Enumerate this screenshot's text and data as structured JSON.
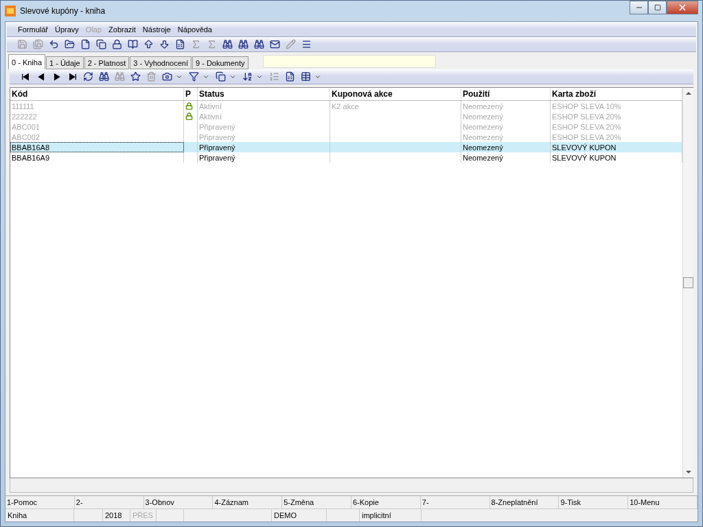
{
  "window": {
    "title": "Slevové kupóny - kniha"
  },
  "menu": [
    {
      "label": "Formulář",
      "disabled": false
    },
    {
      "label": "Úpravy",
      "disabled": false
    },
    {
      "label": "Olap",
      "disabled": true
    },
    {
      "label": "Zobrazit",
      "disabled": false
    },
    {
      "label": "Nástroje",
      "disabled": false
    },
    {
      "label": "Nápověda",
      "disabled": false
    }
  ],
  "toolbar": [
    {
      "kind": "save",
      "disabled": true
    },
    {
      "kind": "save-as",
      "disabled": true
    },
    {
      "kind": "undo",
      "disabled": false
    },
    {
      "kind": "open",
      "disabled": false
    },
    {
      "kind": "new",
      "disabled": false
    },
    {
      "kind": "copy",
      "disabled": false
    },
    {
      "kind": "lock",
      "disabled": false
    },
    {
      "kind": "book",
      "disabled": false
    },
    {
      "kind": "up",
      "disabled": false
    },
    {
      "kind": "down",
      "disabled": false
    },
    {
      "kind": "sheet",
      "disabled": false
    },
    {
      "kind": "sum",
      "disabled": true
    },
    {
      "kind": "sum",
      "disabled": true
    },
    {
      "kind": "find",
      "disabled": false
    },
    {
      "kind": "find",
      "disabled": false
    },
    {
      "kind": "find",
      "disabled": false
    },
    {
      "kind": "mail",
      "disabled": false
    },
    {
      "kind": "edit",
      "disabled": true
    },
    {
      "kind": "menu",
      "disabled": false
    }
  ],
  "tabs": [
    {
      "label": "0 - Kniha",
      "selected": true
    },
    {
      "label": "1 - Údaje",
      "selected": false
    },
    {
      "label": "2 - Platnost",
      "selected": false
    },
    {
      "label": "3 - Vyhodnocení",
      "selected": false
    },
    {
      "label": "9 - Dokumenty",
      "selected": false
    }
  ],
  "grid_toolbar": [
    {
      "kind": "first",
      "disabled": false
    },
    {
      "kind": "prev",
      "disabled": false
    },
    {
      "kind": "next",
      "disabled": false
    },
    {
      "kind": "last",
      "disabled": false
    },
    {
      "kind": "refresh",
      "disabled": false
    },
    {
      "kind": "find",
      "disabled": false
    },
    {
      "kind": "find",
      "disabled": true
    },
    {
      "kind": "star",
      "disabled": false
    },
    {
      "kind": "remove",
      "disabled": true
    },
    {
      "kind": "camera",
      "disabled": false,
      "dropdown": true
    },
    {
      "kind": "filter",
      "disabled": false,
      "dropdown": true
    },
    {
      "kind": "copy",
      "disabled": false,
      "dropdown": true
    },
    {
      "kind": "sort",
      "disabled": false,
      "dropdown": true
    },
    {
      "kind": "list",
      "disabled": true
    },
    {
      "kind": "sheet",
      "disabled": false
    },
    {
      "kind": "table",
      "disabled": false,
      "dropdown": true
    }
  ],
  "table": {
    "columns": [
      "Kód",
      "P",
      "Status",
      "Kuponová akce",
      "Použití",
      "Karta zboží"
    ],
    "rows": [
      {
        "cells": [
          "111111",
          "",
          "Aktivní",
          "K2 akce",
          "Neomezený",
          "ESHOP SLEVA 10%"
        ],
        "locked": true,
        "dimmed": true,
        "selected": false
      },
      {
        "cells": [
          "222222",
          "",
          "Aktivní",
          "",
          "Neomezený",
          "ESHOP SLEVA 20%"
        ],
        "locked": true,
        "dimmed": true,
        "selected": false
      },
      {
        "cells": [
          "ABC001",
          "",
          "Připravený",
          "",
          "Neomezený",
          "ESHOP SLEVA 20%"
        ],
        "locked": false,
        "dimmed": true,
        "selected": false
      },
      {
        "cells": [
          "ABC002",
          "",
          "Připravený",
          "",
          "Neomezený",
          "ESHOP SLEVA 20%"
        ],
        "locked": false,
        "dimmed": true,
        "selected": false
      },
      {
        "cells": [
          "BBAB16A8",
          "",
          "Připravený",
          "",
          "Neomezený",
          "SLEVOVÝ KUPON"
        ],
        "locked": false,
        "dimmed": false,
        "selected": true
      },
      {
        "cells": [
          "BBAB16A9",
          "",
          "Připravený",
          "",
          "Neomezený",
          "SLEVOVÝ KUPON"
        ],
        "locked": false,
        "dimmed": false,
        "selected": false
      }
    ]
  },
  "function_keys": [
    "1-Pomoc",
    "2-",
    "3-Obnov",
    "4-Záznam",
    "5-Změna",
    "6-Kopie",
    "7-",
    "8-Zneplatnění",
    "9-Tisk",
    "10-Menu"
  ],
  "status_bar": [
    {
      "kind": "text",
      "text": "Kniha",
      "disabled": false
    },
    {
      "kind": "blank"
    },
    {
      "kind": "text",
      "text": "2018",
      "disabled": false
    },
    {
      "kind": "text",
      "text": "PŘES",
      "disabled": true
    },
    {
      "kind": "blank"
    },
    {
      "kind": "blank"
    },
    {
      "kind": "text",
      "text": "DEMO",
      "disabled": false
    },
    {
      "kind": "blank"
    },
    {
      "kind": "text",
      "text": "implicitní",
      "disabled": false
    }
  ]
}
